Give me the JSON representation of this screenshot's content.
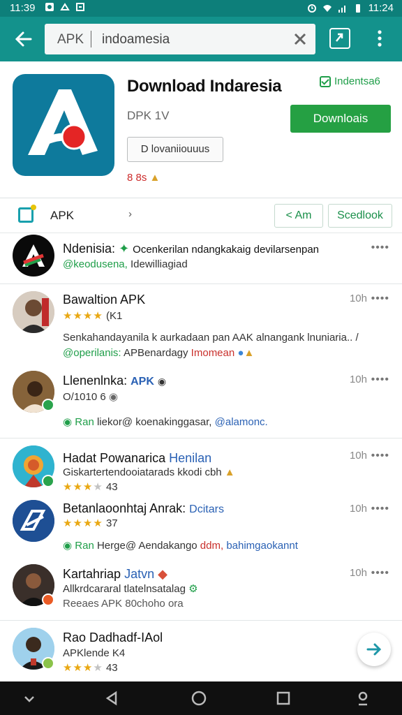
{
  "status_bar": {
    "time_left": "11:39",
    "time_right": "11:24"
  },
  "search": {
    "prefix": "APK",
    "query": "indoamesia"
  },
  "app": {
    "title": "Download Indaresia",
    "version": "DPK 1V",
    "developer_button": "D lovaniiouuus",
    "rating_text": "8 8s",
    "verified_label": "Indentsa6",
    "download_label": "Downloais"
  },
  "filter": {
    "label": "APK",
    "chevron": "›",
    "chip_1": "< Am",
    "chip_2": "Scedlook"
  },
  "list": [
    {
      "name": "Ndenisia:",
      "name_extra": "Ocenkerilan ndangkakaig devilarsenpan",
      "line2_green": "@keodusena,",
      "line2_rest": " Idewilliagiad",
      "time": "",
      "dots": "••••"
    },
    {
      "name": "Bawaltion APK",
      "time": "10h",
      "dots": "••••",
      "rating_count": "(K1",
      "body": "Senkahandayanila k aurkadaan pan AAK alnangank lnuniaria.. /",
      "tags_green": "@operilanis:",
      "tags_rest": " APBenardagy",
      "tags_red": " Imomean"
    },
    {
      "name": "Llenenlnka:",
      "name_tag": "APK",
      "time": "10h",
      "dots": "••••",
      "sub": "O/1010 6",
      "footer_green": "Ran",
      "footer_rest": " liekor@ koenakinggasar,",
      "footer_blue": " @alamonc."
    },
    {
      "name": "Hadat Powanarica",
      "name_tag": "Henilan",
      "time": "10h",
      "dots": "••••",
      "sub": "Giskartertendooiatarads kkodi cbh",
      "rating_count": "43"
    },
    {
      "name": "Betanlaoonhtaj Anrak:",
      "name_tag": "Dcitars",
      "time": "10h",
      "dots": "••••",
      "rating_count": "37",
      "footer_green": "Ran",
      "footer_rest": " Herge@ Aendakango",
      "footer_red": " ddm,",
      "footer_blue": " bahimgaokannt"
    },
    {
      "name": "Kartahriap",
      "name_tag": "Jatvn",
      "time": "10h",
      "dots": "••••",
      "sub": "Allkrdcararal tlatelnsatalag",
      "footer": "Reeaes APK 80choho ora"
    },
    {
      "name": "Rao Dadhadf-IAol",
      "sub": "APKlende K4",
      "rating_count": "43"
    }
  ],
  "colors": {
    "appbar": "#13928c",
    "statusbar": "#0d7f7a",
    "download": "#25a043",
    "accent_green": "#1f9e49"
  }
}
